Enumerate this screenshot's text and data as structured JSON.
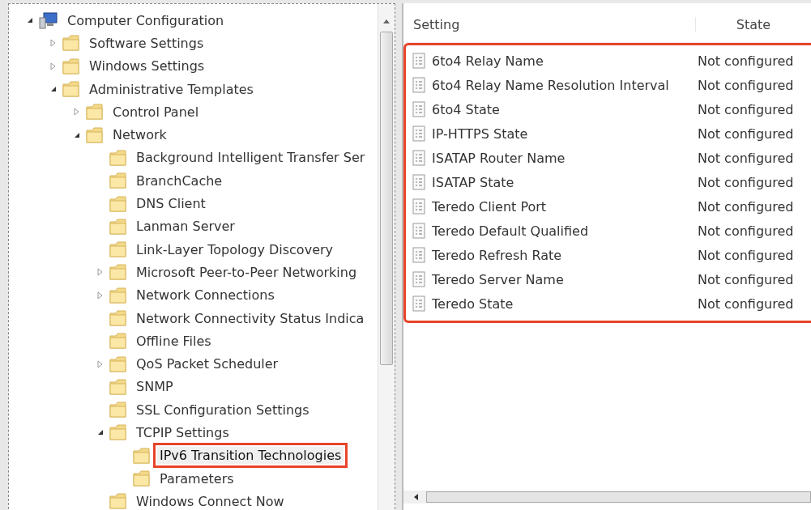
{
  "tree": [
    {
      "label": "Computer Configuration",
      "kind": "computer",
      "expanded": true,
      "selected": false,
      "children": [
        {
          "label": "Software Settings",
          "kind": "folder",
          "expanded": false,
          "selected": false
        },
        {
          "label": "Windows Settings",
          "kind": "folder",
          "expanded": false,
          "selected": false
        },
        {
          "label": "Administrative Templates",
          "kind": "folder",
          "expanded": true,
          "selected": false,
          "children": [
            {
              "label": "Control Panel",
              "kind": "folder",
              "expanded": false,
              "selected": false
            },
            {
              "label": "Network",
              "kind": "folder",
              "expanded": true,
              "selected": false,
              "children": [
                {
                  "label": "Background Intelligent Transfer Ser",
                  "kind": "folder",
                  "selected": false
                },
                {
                  "label": "BranchCache",
                  "kind": "folder",
                  "selected": false
                },
                {
                  "label": "DNS Client",
                  "kind": "folder",
                  "selected": false
                },
                {
                  "label": "Lanman Server",
                  "kind": "folder",
                  "selected": false
                },
                {
                  "label": "Link-Layer Topology Discovery",
                  "kind": "folder",
                  "selected": false
                },
                {
                  "label": "Microsoft Peer-to-Peer Networking",
                  "kind": "folder",
                  "expanded": false,
                  "selected": false
                },
                {
                  "label": "Network Connections",
                  "kind": "folder",
                  "expanded": false,
                  "selected": false
                },
                {
                  "label": "Network Connectivity Status Indica",
                  "kind": "folder",
                  "selected": false
                },
                {
                  "label": "Offline Files",
                  "kind": "folder",
                  "selected": false
                },
                {
                  "label": "QoS Packet Scheduler",
                  "kind": "folder",
                  "expanded": false,
                  "selected": false
                },
                {
                  "label": "SNMP",
                  "kind": "folder",
                  "selected": false
                },
                {
                  "label": "SSL Configuration Settings",
                  "kind": "folder",
                  "selected": false
                },
                {
                  "label": "TCPIP Settings",
                  "kind": "folder",
                  "expanded": true,
                  "selected": false,
                  "children": [
                    {
                      "label": "IPv6 Transition Technologies",
                      "kind": "folder",
                      "selected": true
                    },
                    {
                      "label": "Parameters",
                      "kind": "folder",
                      "selected": false
                    }
                  ]
                },
                {
                  "label": "Windows Connect Now",
                  "kind": "folder",
                  "selected": false
                }
              ]
            }
          ]
        }
      ]
    }
  ],
  "table": {
    "columns": [
      "Setting",
      "State"
    ],
    "rows": [
      {
        "setting": "6to4 Relay Name",
        "state": "Not configured"
      },
      {
        "setting": "6to4 Relay Name Resolution Interval",
        "state": "Not configured"
      },
      {
        "setting": "6to4 State",
        "state": "Not configured"
      },
      {
        "setting": "IP-HTTPS State",
        "state": "Not configured"
      },
      {
        "setting": "ISATAP Router Name",
        "state": "Not configured"
      },
      {
        "setting": "ISATAP State",
        "state": "Not configured"
      },
      {
        "setting": "Teredo Client Port",
        "state": "Not configured"
      },
      {
        "setting": "Teredo Default Qualified",
        "state": "Not configured"
      },
      {
        "setting": "Teredo Refresh Rate",
        "state": "Not configured"
      },
      {
        "setting": "Teredo Server Name",
        "state": "Not configured"
      },
      {
        "setting": "Teredo State",
        "state": "Not configured"
      }
    ]
  }
}
